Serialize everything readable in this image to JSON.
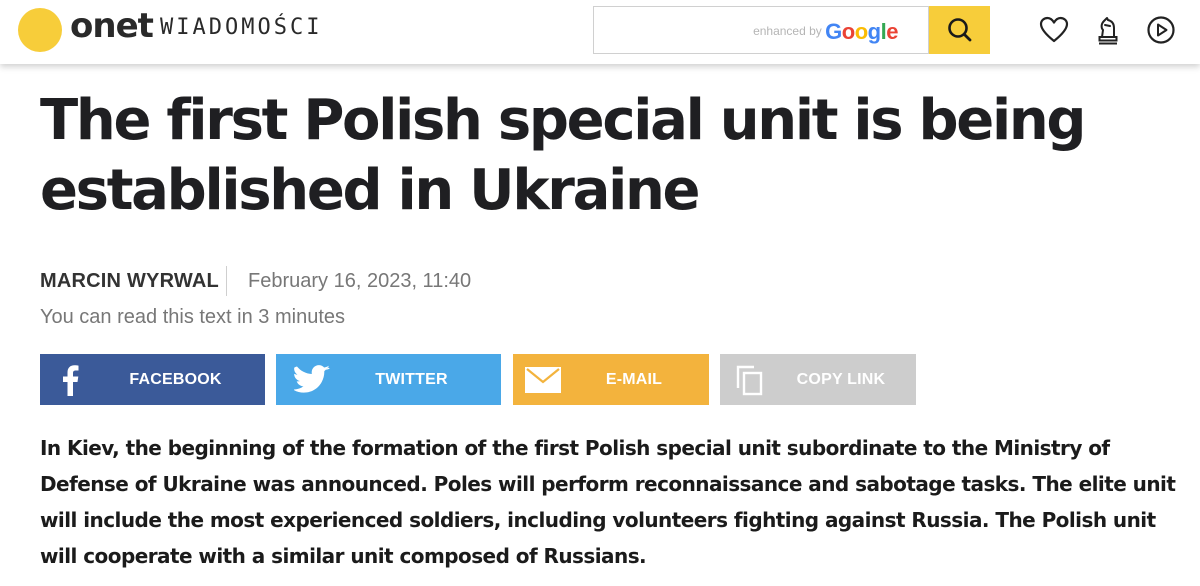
{
  "header": {
    "logo_text": "onet",
    "section": "WIADOMOŚCI",
    "search": {
      "placeholder": "",
      "enhanced_by": "enhanced by",
      "google_letters": [
        "G",
        "o",
        "o",
        "g",
        "l",
        "e"
      ],
      "google_colors": [
        "#4285F4",
        "#EA4335",
        "#FBBC05",
        "#4285F4",
        "#34A853",
        "#EA4335"
      ]
    },
    "icons": [
      "search-icon",
      "heart-icon",
      "chess-knight-icon",
      "play-icon"
    ]
  },
  "article": {
    "title": "The first Polish special unit is being established in Ukraine",
    "author": "MARCIN WYRWAL",
    "date": "February 16, 2023, 11:40",
    "read_time": "You can read this text in 3 minutes",
    "lead": "In Kiev, the beginning of the formation of the first Polish special unit subordinate to the Ministry of Defense of Ukraine was announced. Poles will perform reconnaissance and sabotage tasks. The elite unit will include the most experienced soldiers, including volunteers fighting against Russia. The Polish unit will cooperate with a similar unit composed of Russians."
  },
  "share": {
    "facebook": {
      "label": "FACEBOOK",
      "color": "#3b5a99",
      "icon": "facebook-icon"
    },
    "twitter": {
      "label": "TWITTER",
      "color": "#4aa8e8",
      "icon": "twitter-icon"
    },
    "email": {
      "label": "E-MAIL",
      "color": "#f3b33d",
      "icon": "envelope-icon"
    },
    "copy": {
      "label": "COPY LINK",
      "color": "#cdcdcd",
      "icon": "copy-icon"
    }
  },
  "colors": {
    "accent": "#f7cd3a",
    "text": "#1f1f22",
    "muted": "#777777"
  }
}
